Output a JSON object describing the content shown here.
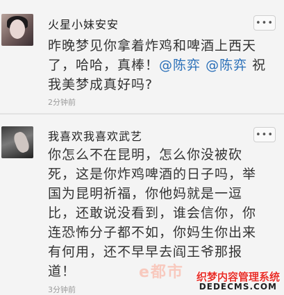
{
  "posts": [
    {
      "username": "火星小妹安安",
      "more_label": "•••",
      "text_before": "昨晚梦见你拿着炸鸡和啤酒上西天了，哈哈，真棒！",
      "mention1": "@陈弈",
      "mention2": "@陈弈",
      "text_after": "祝我美梦成真好吗?",
      "timestamp": "2分钟前"
    },
    {
      "username": "我喜欢我喜欢武艺",
      "more_label": "•••",
      "text": "你怎么不在昆明，怎么你没被砍死，这是你炸鸡啤酒的日子吗，举国为昆明祈福，你他妈就是一逗比，还敢说没看到，谁会信你，你连恐怖分子都不如，你妈生你出来有何用，还不早早去阎王爷那报道！",
      "timestamp": "3分钟前"
    }
  ],
  "watermark": {
    "logo": "e都市",
    "site_name": "织梦内容管理系统",
    "domain": "DEDECMS.COM"
  },
  "colors": {
    "mention": "#2a6fb8",
    "background": "#f4f4f4"
  }
}
